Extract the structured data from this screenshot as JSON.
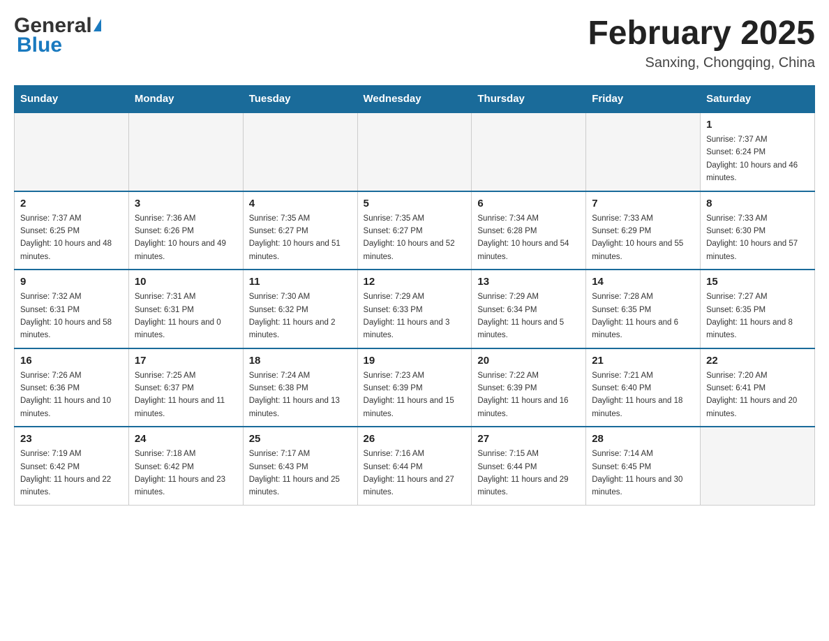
{
  "header": {
    "logo_general": "General",
    "logo_blue": "Blue",
    "title": "February 2025",
    "location": "Sanxing, Chongqing, China"
  },
  "weekdays": [
    "Sunday",
    "Monday",
    "Tuesday",
    "Wednesday",
    "Thursday",
    "Friday",
    "Saturday"
  ],
  "weeks": [
    [
      {
        "day": "",
        "sunrise": "",
        "sunset": "",
        "daylight": "",
        "empty": true
      },
      {
        "day": "",
        "sunrise": "",
        "sunset": "",
        "daylight": "",
        "empty": true
      },
      {
        "day": "",
        "sunrise": "",
        "sunset": "",
        "daylight": "",
        "empty": true
      },
      {
        "day": "",
        "sunrise": "",
        "sunset": "",
        "daylight": "",
        "empty": true
      },
      {
        "day": "",
        "sunrise": "",
        "sunset": "",
        "daylight": "",
        "empty": true
      },
      {
        "day": "",
        "sunrise": "",
        "sunset": "",
        "daylight": "",
        "empty": true
      },
      {
        "day": "1",
        "sunrise": "Sunrise: 7:37 AM",
        "sunset": "Sunset: 6:24 PM",
        "daylight": "Daylight: 10 hours and 46 minutes.",
        "empty": false
      }
    ],
    [
      {
        "day": "2",
        "sunrise": "Sunrise: 7:37 AM",
        "sunset": "Sunset: 6:25 PM",
        "daylight": "Daylight: 10 hours and 48 minutes.",
        "empty": false
      },
      {
        "day": "3",
        "sunrise": "Sunrise: 7:36 AM",
        "sunset": "Sunset: 6:26 PM",
        "daylight": "Daylight: 10 hours and 49 minutes.",
        "empty": false
      },
      {
        "day": "4",
        "sunrise": "Sunrise: 7:35 AM",
        "sunset": "Sunset: 6:27 PM",
        "daylight": "Daylight: 10 hours and 51 minutes.",
        "empty": false
      },
      {
        "day": "5",
        "sunrise": "Sunrise: 7:35 AM",
        "sunset": "Sunset: 6:27 PM",
        "daylight": "Daylight: 10 hours and 52 minutes.",
        "empty": false
      },
      {
        "day": "6",
        "sunrise": "Sunrise: 7:34 AM",
        "sunset": "Sunset: 6:28 PM",
        "daylight": "Daylight: 10 hours and 54 minutes.",
        "empty": false
      },
      {
        "day": "7",
        "sunrise": "Sunrise: 7:33 AM",
        "sunset": "Sunset: 6:29 PM",
        "daylight": "Daylight: 10 hours and 55 minutes.",
        "empty": false
      },
      {
        "day": "8",
        "sunrise": "Sunrise: 7:33 AM",
        "sunset": "Sunset: 6:30 PM",
        "daylight": "Daylight: 10 hours and 57 minutes.",
        "empty": false
      }
    ],
    [
      {
        "day": "9",
        "sunrise": "Sunrise: 7:32 AM",
        "sunset": "Sunset: 6:31 PM",
        "daylight": "Daylight: 10 hours and 58 minutes.",
        "empty": false
      },
      {
        "day": "10",
        "sunrise": "Sunrise: 7:31 AM",
        "sunset": "Sunset: 6:31 PM",
        "daylight": "Daylight: 11 hours and 0 minutes.",
        "empty": false
      },
      {
        "day": "11",
        "sunrise": "Sunrise: 7:30 AM",
        "sunset": "Sunset: 6:32 PM",
        "daylight": "Daylight: 11 hours and 2 minutes.",
        "empty": false
      },
      {
        "day": "12",
        "sunrise": "Sunrise: 7:29 AM",
        "sunset": "Sunset: 6:33 PM",
        "daylight": "Daylight: 11 hours and 3 minutes.",
        "empty": false
      },
      {
        "day": "13",
        "sunrise": "Sunrise: 7:29 AM",
        "sunset": "Sunset: 6:34 PM",
        "daylight": "Daylight: 11 hours and 5 minutes.",
        "empty": false
      },
      {
        "day": "14",
        "sunrise": "Sunrise: 7:28 AM",
        "sunset": "Sunset: 6:35 PM",
        "daylight": "Daylight: 11 hours and 6 minutes.",
        "empty": false
      },
      {
        "day": "15",
        "sunrise": "Sunrise: 7:27 AM",
        "sunset": "Sunset: 6:35 PM",
        "daylight": "Daylight: 11 hours and 8 minutes.",
        "empty": false
      }
    ],
    [
      {
        "day": "16",
        "sunrise": "Sunrise: 7:26 AM",
        "sunset": "Sunset: 6:36 PM",
        "daylight": "Daylight: 11 hours and 10 minutes.",
        "empty": false
      },
      {
        "day": "17",
        "sunrise": "Sunrise: 7:25 AM",
        "sunset": "Sunset: 6:37 PM",
        "daylight": "Daylight: 11 hours and 11 minutes.",
        "empty": false
      },
      {
        "day": "18",
        "sunrise": "Sunrise: 7:24 AM",
        "sunset": "Sunset: 6:38 PM",
        "daylight": "Daylight: 11 hours and 13 minutes.",
        "empty": false
      },
      {
        "day": "19",
        "sunrise": "Sunrise: 7:23 AM",
        "sunset": "Sunset: 6:39 PM",
        "daylight": "Daylight: 11 hours and 15 minutes.",
        "empty": false
      },
      {
        "day": "20",
        "sunrise": "Sunrise: 7:22 AM",
        "sunset": "Sunset: 6:39 PM",
        "daylight": "Daylight: 11 hours and 16 minutes.",
        "empty": false
      },
      {
        "day": "21",
        "sunrise": "Sunrise: 7:21 AM",
        "sunset": "Sunset: 6:40 PM",
        "daylight": "Daylight: 11 hours and 18 minutes.",
        "empty": false
      },
      {
        "day": "22",
        "sunrise": "Sunrise: 7:20 AM",
        "sunset": "Sunset: 6:41 PM",
        "daylight": "Daylight: 11 hours and 20 minutes.",
        "empty": false
      }
    ],
    [
      {
        "day": "23",
        "sunrise": "Sunrise: 7:19 AM",
        "sunset": "Sunset: 6:42 PM",
        "daylight": "Daylight: 11 hours and 22 minutes.",
        "empty": false
      },
      {
        "day": "24",
        "sunrise": "Sunrise: 7:18 AM",
        "sunset": "Sunset: 6:42 PM",
        "daylight": "Daylight: 11 hours and 23 minutes.",
        "empty": false
      },
      {
        "day": "25",
        "sunrise": "Sunrise: 7:17 AM",
        "sunset": "Sunset: 6:43 PM",
        "daylight": "Daylight: 11 hours and 25 minutes.",
        "empty": false
      },
      {
        "day": "26",
        "sunrise": "Sunrise: 7:16 AM",
        "sunset": "Sunset: 6:44 PM",
        "daylight": "Daylight: 11 hours and 27 minutes.",
        "empty": false
      },
      {
        "day": "27",
        "sunrise": "Sunrise: 7:15 AM",
        "sunset": "Sunset: 6:44 PM",
        "daylight": "Daylight: 11 hours and 29 minutes.",
        "empty": false
      },
      {
        "day": "28",
        "sunrise": "Sunrise: 7:14 AM",
        "sunset": "Sunset: 6:45 PM",
        "daylight": "Daylight: 11 hours and 30 minutes.",
        "empty": false
      },
      {
        "day": "",
        "sunrise": "",
        "sunset": "",
        "daylight": "",
        "empty": true
      }
    ]
  ]
}
